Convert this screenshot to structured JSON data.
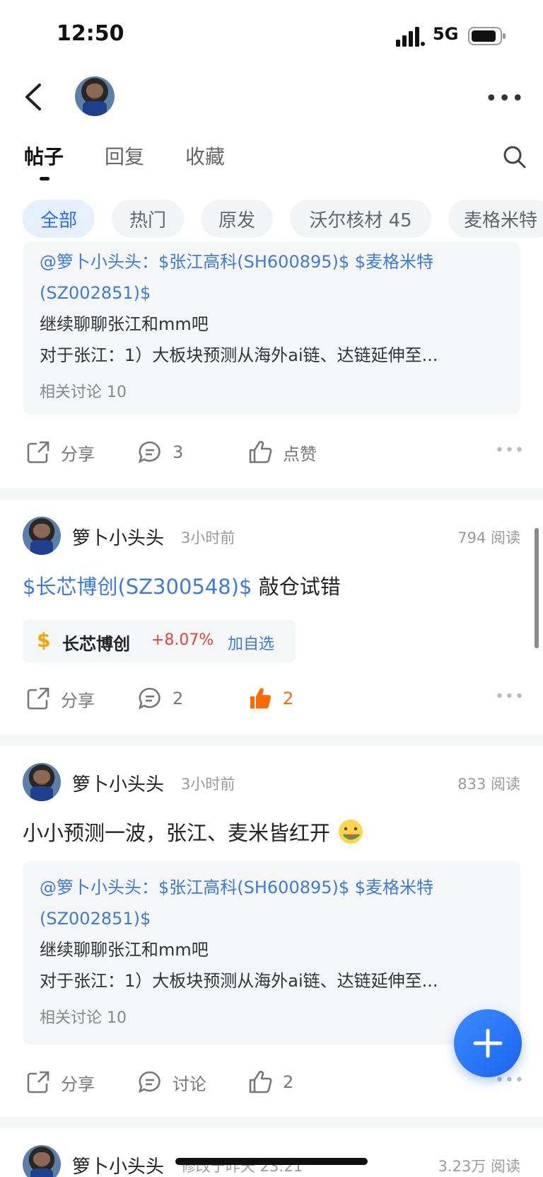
{
  "status_bar": {
    "time": "12:50",
    "network": "5G"
  },
  "header": {
    "back_icon": "chevron-left-icon",
    "more_icon": "more-horizontal-icon"
  },
  "tabs": [
    {
      "label": "帖子",
      "active": true
    },
    {
      "label": "回复",
      "active": false
    },
    {
      "label": "收藏",
      "active": false
    }
  ],
  "filters": [
    {
      "label": "全部",
      "active": true
    },
    {
      "label": "热门",
      "active": false
    },
    {
      "label": "原发",
      "active": false
    },
    {
      "label": "沃尔核材 45",
      "active": false
    },
    {
      "label": "麦格米特",
      "active": false
    }
  ],
  "post1": {
    "quote_link": "@箩卜小头头：$张江高科(SH600895)$ $麦格米特",
    "quote_link2": "(SZ002851)$",
    "quote_line1": "继续聊聊张江和mm吧",
    "quote_line2": "对于张江：1）大板块预测从海外ai链、达链延伸至...",
    "related": "相关讨论 10",
    "share": "分享",
    "comments": "3",
    "like": "点赞"
  },
  "post2": {
    "author": "箩卜小头头",
    "time": "3小时前",
    "reads": "794 阅读",
    "title_link": "$长芯博创(SZ300548)$",
    "title_text": " 敲仓试错",
    "stock": {
      "symbol": "$",
      "name": "长芯博创",
      "change": "+8.07%",
      "add": "加自选"
    },
    "share": "分享",
    "comments": "2",
    "likes": "2"
  },
  "post3": {
    "author": "箩卜小头头",
    "time": "3小时前",
    "reads": "833 阅读",
    "title": "小小预测一波，张江、麦米皆红开",
    "quote_link": "@箩卜小头头：$张江高科(SH600895)$ $麦格米特",
    "quote_link2": "(SZ002851)$",
    "quote_line1": "继续聊聊张江和mm吧",
    "quote_line2": "对于张江：1）大板块预测从海外ai链、达链延伸至...",
    "related": "相关讨论 10",
    "share": "分享",
    "comments": "讨论",
    "likes": "2"
  },
  "post4": {
    "author": "箩卜小头头",
    "time": "修改于昨天 23:21",
    "reads": "3.23万 阅读"
  },
  "colors": {
    "accent": "#3b7bdf",
    "like_active": "#ff6a00",
    "up": "#e7403e"
  }
}
